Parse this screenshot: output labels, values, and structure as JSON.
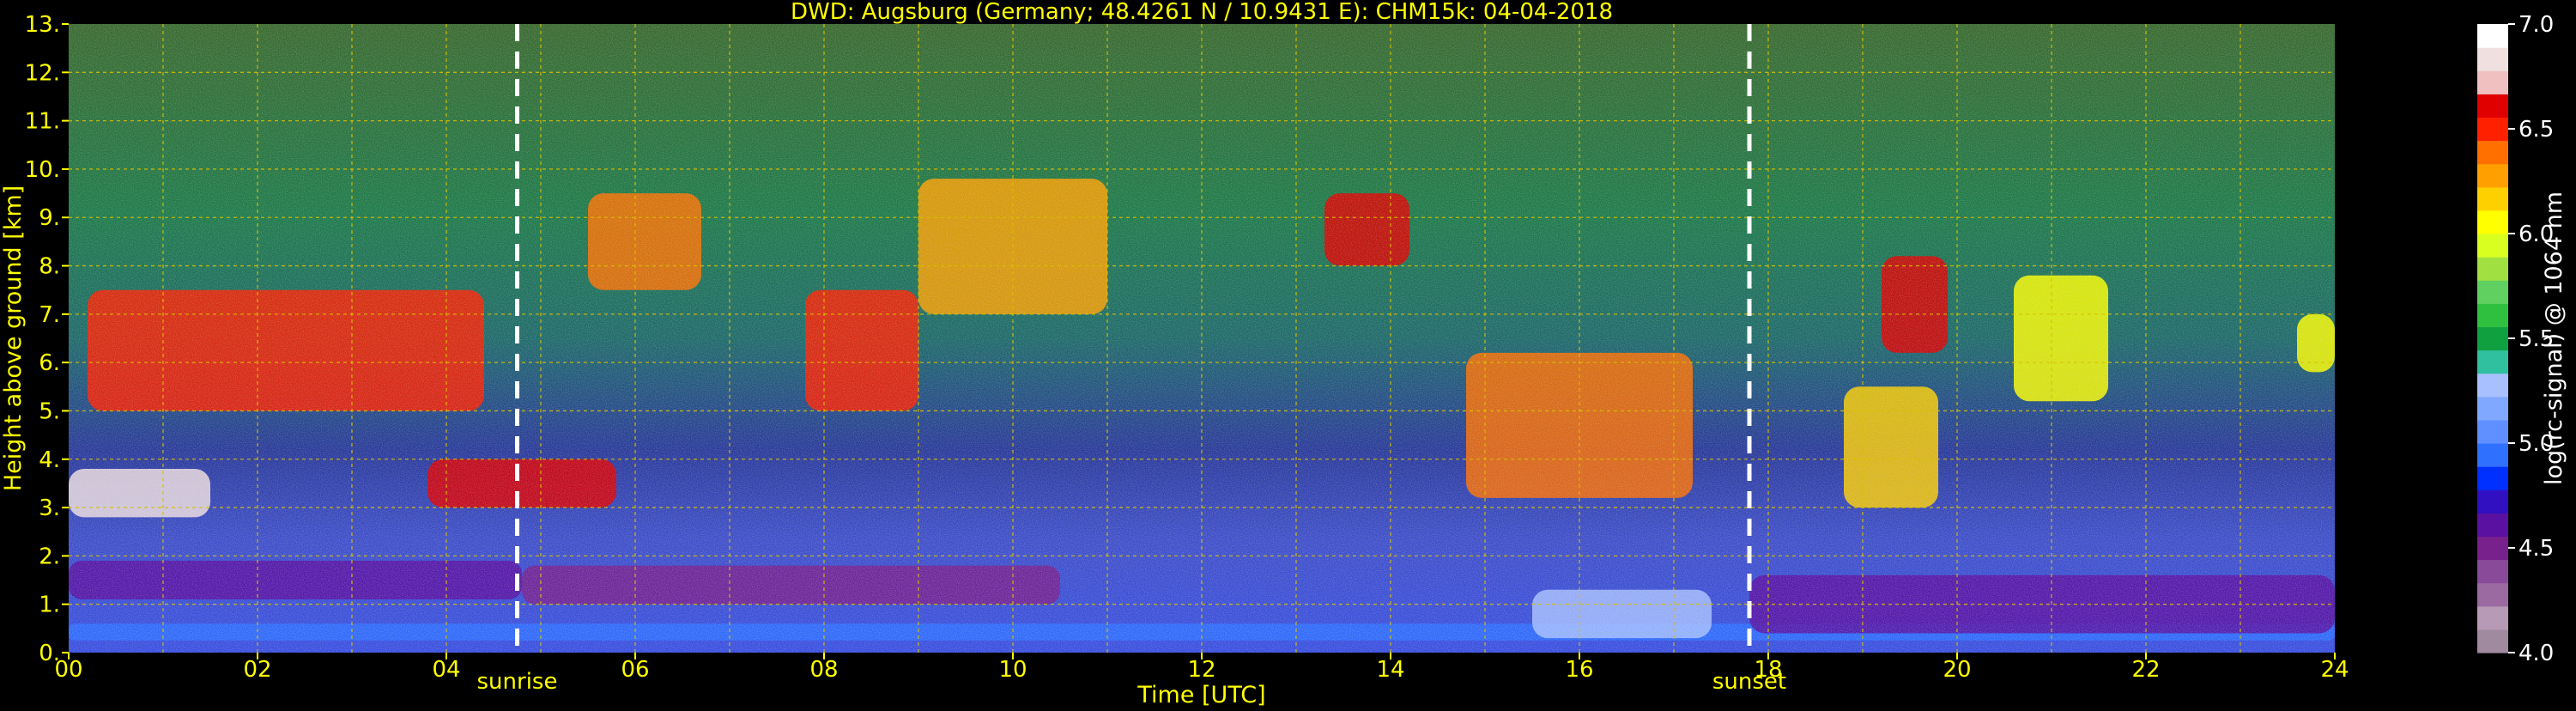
{
  "chart_data": {
    "type": "heatmap",
    "title": "DWD: Augsburg (Germany; 48.4261 N / 10.9431 E):    CHM15k: 04-04-2018",
    "xlabel": "Time [UTC]",
    "ylabel": "Height above ground [km]",
    "x_ticks": [
      "00",
      "02",
      "04",
      "06",
      "08",
      "10",
      "12",
      "14",
      "16",
      "18",
      "20",
      "22",
      "24"
    ],
    "y_ticks": [
      "0.",
      "1.",
      "2.",
      "3.",
      "4.",
      "5.",
      "6.",
      "7.",
      "8.",
      "9.",
      "10.",
      "11.",
      "12.",
      "13."
    ],
    "xlim": [
      0,
      24
    ],
    "ylim": [
      0,
      13
    ],
    "grid": true,
    "events": [
      {
        "label": "sunrise",
        "time_utc": 4.75
      },
      {
        "label": "sunset",
        "time_utc": 17.8
      }
    ],
    "colorbar": {
      "label": "log(rc-signal) @ 1064 nm",
      "ticks": [
        "4.0",
        "4.5",
        "5.0",
        "5.5",
        "6.0",
        "6.5",
        "7.0"
      ],
      "range": [
        4.0,
        7.0
      ],
      "colors": [
        "#a08aa0",
        "#b79ab5",
        "#9a6aa0",
        "#8a4a9a",
        "#78208c",
        "#5a10a0",
        "#3010c0",
        "#0030ff",
        "#3070ff",
        "#6090ff",
        "#80a8ff",
        "#a8c0ff",
        "#30c0a0",
        "#10a040",
        "#30c040",
        "#60d060",
        "#a0e040",
        "#d8ff20",
        "#ffff00",
        "#ffd000",
        "#ffa000",
        "#ff7000",
        "#ff2000",
        "#e00000",
        "#f0c0c0",
        "#f0e0e0",
        "#ffffff"
      ]
    },
    "colors": {
      "background": "#000000",
      "text": "#ffff00",
      "grid": "#d8c000",
      "event_lines": "#ffffff",
      "axis_label": "#ffff00",
      "colorbar_label": "#ffffff"
    },
    "layers": [
      {
        "t_start": 0,
        "t_end": 24,
        "h_bottom": 0.25,
        "h_top": 0.6,
        "value": 4.9
      },
      {
        "t_start": 0,
        "t_end": 4.8,
        "h_bottom": 1.1,
        "h_top": 1.9,
        "value": 4.65
      },
      {
        "t_start": 4.8,
        "t_end": 10.5,
        "h_bottom": 1.0,
        "h_top": 1.8,
        "value": 4.55
      },
      {
        "t_start": 15.5,
        "t_end": 17.4,
        "h_bottom": 0.3,
        "h_top": 1.3,
        "value": 5.3
      },
      {
        "t_start": 17.8,
        "t_end": 24,
        "h_bottom": 0.4,
        "h_top": 1.6,
        "value": 4.6
      },
      {
        "t_start": 0,
        "t_end": 1.5,
        "h_bottom": 2.8,
        "h_top": 3.8,
        "value": 6.8
      },
      {
        "t_start": 3.8,
        "t_end": 5.8,
        "h_bottom": 3.0,
        "h_top": 4.0,
        "value": 6.6
      },
      {
        "t_start": 0.2,
        "t_end": 4.4,
        "h_bottom": 5.0,
        "h_top": 7.5,
        "value": 6.5
      },
      {
        "t_start": 5.5,
        "t_end": 6.7,
        "h_bottom": 7.5,
        "h_top": 9.5,
        "value": 6.4
      },
      {
        "t_start": 7.8,
        "t_end": 9.0,
        "h_bottom": 5.0,
        "h_top": 7.5,
        "value": 6.5
      },
      {
        "t_start": 9.0,
        "t_end": 11.0,
        "h_bottom": 7.0,
        "h_top": 9.8,
        "value": 6.3
      },
      {
        "t_start": 13.3,
        "t_end": 14.2,
        "h_bottom": 8.0,
        "h_top": 9.5,
        "value": 6.6
      },
      {
        "t_start": 14.8,
        "t_end": 17.2,
        "h_bottom": 3.2,
        "h_top": 6.2,
        "value": 6.4
      },
      {
        "t_start": 19.2,
        "t_end": 19.9,
        "h_bottom": 6.2,
        "h_top": 8.2,
        "value": 6.6
      },
      {
        "t_start": 18.8,
        "t_end": 19.8,
        "h_bottom": 3.0,
        "h_top": 5.5,
        "value": 6.2
      },
      {
        "t_start": 20.6,
        "t_end": 21.6,
        "h_bottom": 5.2,
        "h_top": 7.8,
        "value": 6.1
      },
      {
        "t_start": 23.6,
        "t_end": 24.0,
        "h_bottom": 5.8,
        "h_top": 7.0,
        "value": 6.0
      }
    ]
  }
}
